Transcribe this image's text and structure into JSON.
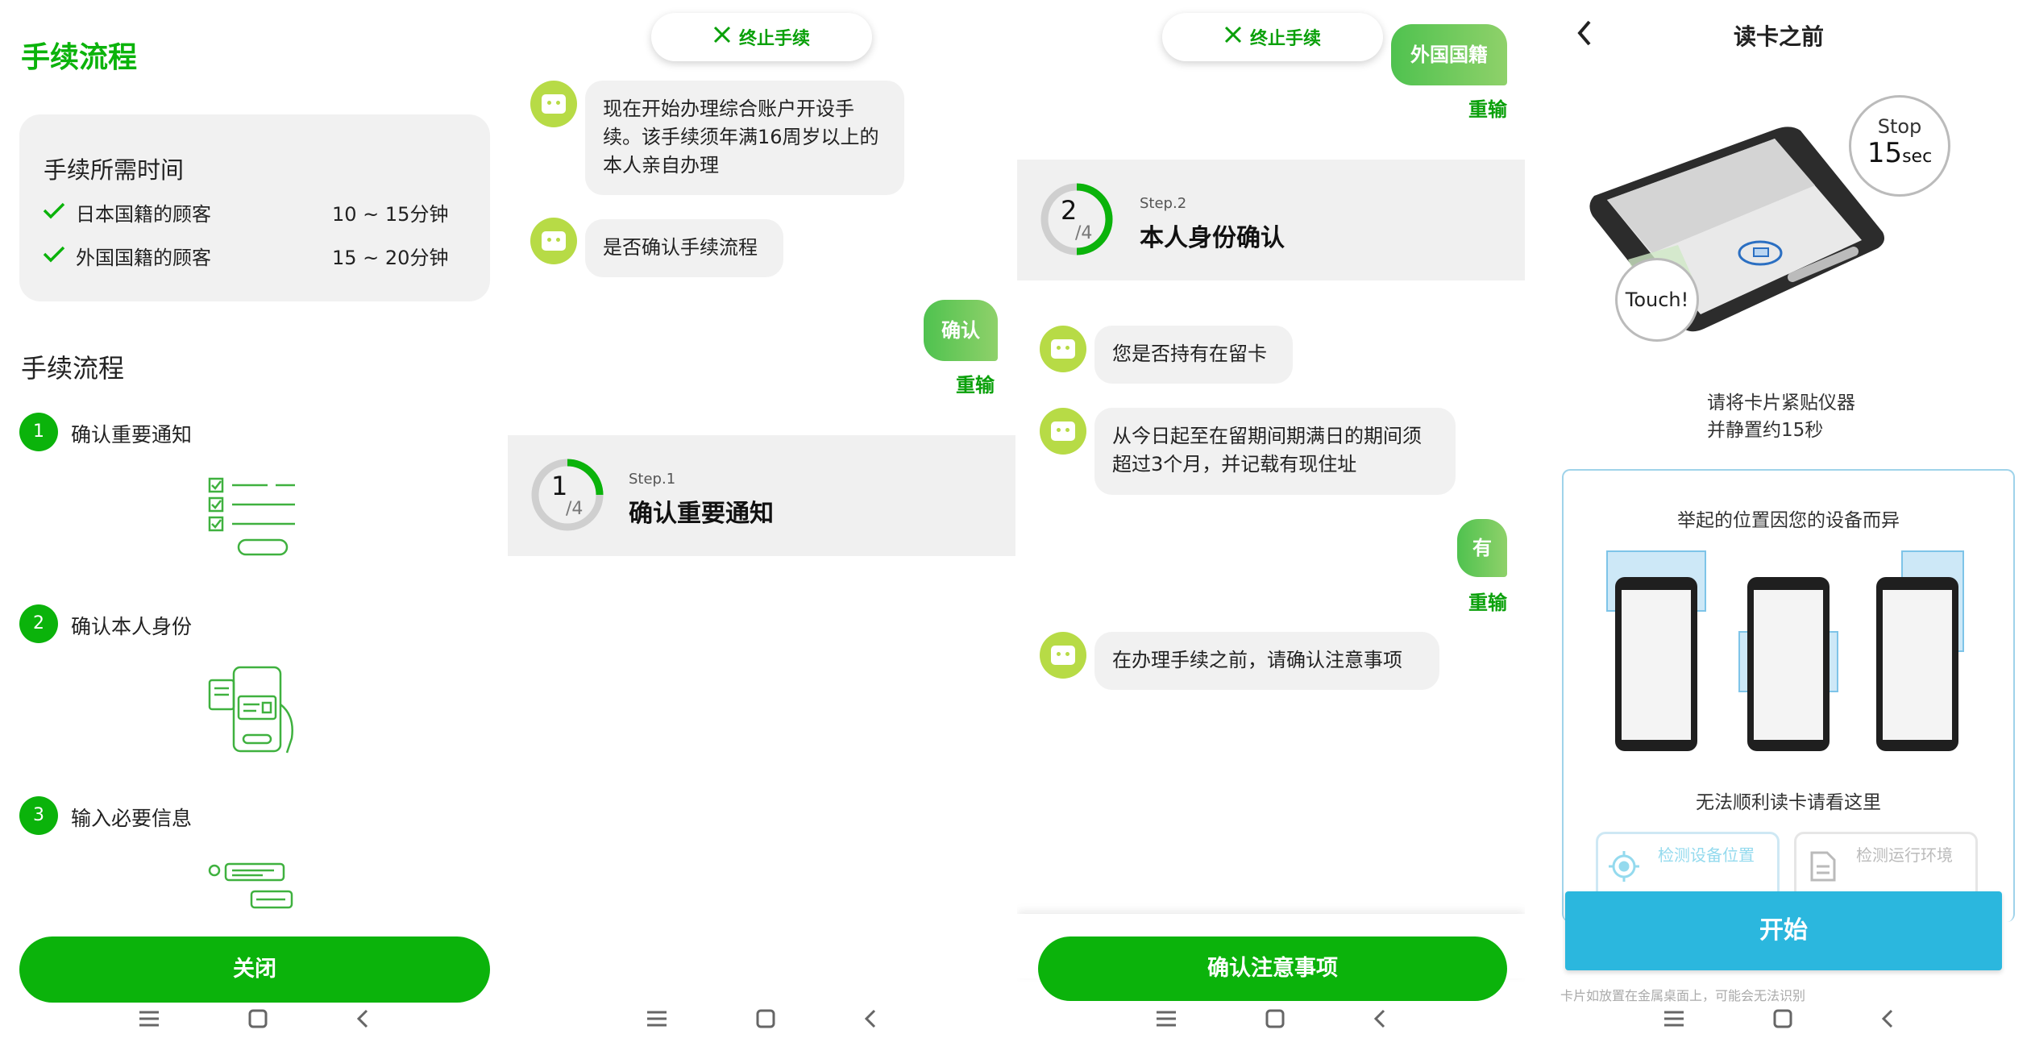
{
  "colors": {
    "green": "#0bb30b",
    "green_text": "#0aa00a",
    "bot": "#b7db46",
    "blue_btn": "#2bb7de",
    "card_bg": "#f1f1f1"
  },
  "screen1": {
    "title": "手续流程",
    "time_card": {
      "heading": "手续所需时间",
      "rows": [
        {
          "label": "日本国籍的顾客",
          "value": "10 ~ 15分钟"
        },
        {
          "label": "外国国籍的顾客",
          "value": "15 ~ 20分钟"
        }
      ]
    },
    "flow_heading": "手续流程",
    "steps": [
      {
        "num": "1",
        "label": "确认重要通知",
        "icon": "checklist-icon"
      },
      {
        "num": "2",
        "label": "确认本人身份",
        "icon": "id-card-hand-icon"
      },
      {
        "num": "3",
        "label": "输入必要信息",
        "icon": "form-input-icon"
      }
    ],
    "close_button": "关闭"
  },
  "screen2": {
    "stop_label": "终止手续",
    "messages": [
      {
        "from": "bot",
        "text": "现在开始办理综合账户开设手续。该手续须年满16周岁以上的本人亲自办理"
      },
      {
        "from": "bot",
        "text": "是否确认手续流程"
      },
      {
        "from": "user",
        "text": "确认"
      }
    ],
    "redo": "重输",
    "step": {
      "label": "Step.1",
      "title": "确认重要通知",
      "current": "1",
      "total": "4",
      "progress": 0.25
    }
  },
  "screen3": {
    "stop_label": "终止手续",
    "user_top": "外国国籍",
    "redo": "重输",
    "step": {
      "label": "Step.2",
      "title": "本人身份确认",
      "current": "2",
      "total": "4",
      "progress": 0.5
    },
    "messages": [
      {
        "from": "bot",
        "text": "您是否持有在留卡"
      },
      {
        "from": "bot",
        "text": "从今日起至在留期间期满日的期间须超过3个月，并记载有现住址"
      },
      {
        "from": "user",
        "text": "有"
      },
      {
        "from": "bot",
        "text": "在办理手续之前，请确认注意事项"
      }
    ],
    "confirm_button": "确认注意事项"
  },
  "screen4": {
    "title": "读卡之前",
    "stop_bubble": {
      "line1": "Stop",
      "big": "15",
      "unit": "sec"
    },
    "touch_bubble": "Touch!",
    "instruction_line1": "请将卡片紧贴仪器",
    "instruction_line2": "并静置约15秒",
    "card_heading": "举起的位置因您的设备而异",
    "trouble_text": "无法顺利读卡请看这里",
    "options": [
      {
        "label": "检测设备位置",
        "icon": "crosshair-icon"
      },
      {
        "label": "检测运行环境",
        "icon": "document-icon"
      }
    ],
    "start_button": "开始",
    "footnote": "卡片如放置在金属桌面上，可能会无法识别"
  }
}
